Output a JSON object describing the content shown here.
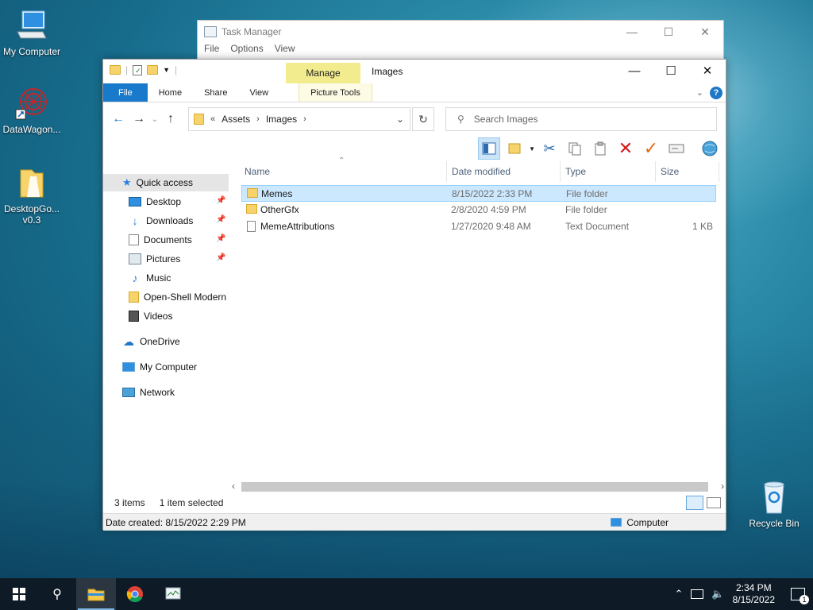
{
  "desktop": {
    "icons": [
      {
        "label": "My Computer"
      },
      {
        "label": "DataWagon..."
      },
      {
        "label": "DesktopGo...",
        "label2": "v0.3"
      },
      {
        "label": "Recycle Bin"
      }
    ]
  },
  "task_manager": {
    "title": "Task Manager",
    "menu": [
      "File",
      "Options",
      "View"
    ]
  },
  "explorer": {
    "manage_label": "Manage",
    "title": "Images",
    "ribbon_tabs": [
      "File",
      "Home",
      "Share",
      "View",
      "Picture Tools"
    ],
    "address": {
      "prefix": "«",
      "crumbs": [
        "Assets",
        "Images"
      ]
    },
    "search_placeholder": "Search Images",
    "nav": {
      "quick_access": "Quick access",
      "items": [
        "Desktop",
        "Downloads",
        "Documents",
        "Pictures",
        "Music",
        "Open-Shell Modern",
        "Videos"
      ],
      "onedrive": "OneDrive",
      "mycomputer": "My Computer",
      "network": "Network"
    },
    "columns": [
      "Name",
      "Date modified",
      "Type",
      "Size"
    ],
    "files": [
      {
        "name": "Memes",
        "date": "8/15/2022 2:33 PM",
        "type": "File folder",
        "size": ""
      },
      {
        "name": "OtherGfx",
        "date": "2/8/2020 4:59 PM",
        "type": "File folder",
        "size": ""
      },
      {
        "name": "MemeAttributions",
        "date": "1/27/2020 9:48 AM",
        "type": "Text Document",
        "size": "1 KB"
      }
    ],
    "status": {
      "items": "3 items",
      "selected": "1 item selected"
    },
    "details": {
      "created": "Date created: 8/15/2022 2:29 PM",
      "location": "Computer"
    }
  },
  "taskbar": {
    "time": "2:34 PM",
    "date": "8/15/2022",
    "notification_count": "1"
  }
}
